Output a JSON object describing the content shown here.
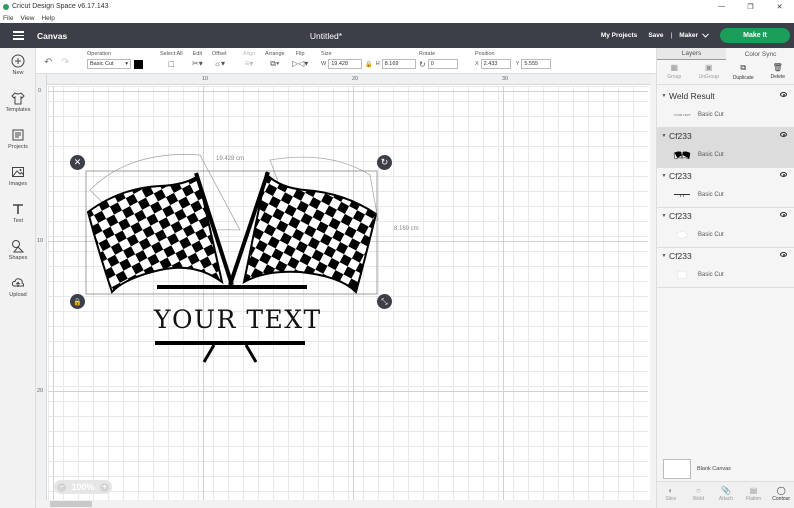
{
  "window": {
    "title": "Cricut Design Space  v6.17.143",
    "minimize": "—",
    "maximize": "❐",
    "close": "✕"
  },
  "menu": [
    "File",
    "View",
    "Help"
  ],
  "header": {
    "section": "Canvas",
    "doc_title": "Untitled*",
    "my_projects": "My Projects",
    "save": "Save",
    "separator": "|",
    "machine": "Maker",
    "make_it": "Make It"
  },
  "toolbar": {
    "operation_label": "Operation",
    "operation_value": "Basic Cut",
    "select_all": "Select All",
    "edit": "Edit",
    "offset": "Offset",
    "align": "Align",
    "arrange": "Arrange",
    "flip": "Flip",
    "size_label": "Size",
    "w_label": "W",
    "w_value": "19.428",
    "h_label": "H",
    "h_value": "8.169",
    "rotate_label": "Rotate",
    "rotate_value": "0",
    "position_label": "Position",
    "x_label": "X",
    "x_value": "2.433",
    "y_label": "Y",
    "y_value": "5.555"
  },
  "sidebar": [
    {
      "label": "New",
      "icon": "plus-icon"
    },
    {
      "label": "Templates",
      "icon": "shirt-icon"
    },
    {
      "label": "Projects",
      "icon": "projects-icon"
    },
    {
      "label": "Images",
      "icon": "image-icon"
    },
    {
      "label": "Text",
      "icon": "text-icon"
    },
    {
      "label": "Shapes",
      "icon": "shapes-icon"
    },
    {
      "label": "Upload",
      "icon": "upload-icon"
    }
  ],
  "ruler": {
    "top": [
      "0",
      "10",
      "20",
      "30"
    ],
    "left": [
      "0",
      "10",
      "20"
    ]
  },
  "canvas": {
    "width_label": "19.428 cm",
    "height_label": "8.169 cm",
    "your_text": "YOUR TEXT",
    "zoom": "100%",
    "zoom_minus": "−",
    "zoom_plus": "+"
  },
  "panel": {
    "tabs": [
      "Layers",
      "Color Sync"
    ],
    "actions": [
      "Group",
      "UnGroup",
      "Duplicate",
      "Delete"
    ],
    "layers": [
      {
        "name": "Weld Result",
        "op": "Basic Cut",
        "thumb_text": "YOUR TEXT"
      },
      {
        "name": "Cf233",
        "op": "Basic Cut"
      },
      {
        "name": "Cf233",
        "op": "Basic Cut"
      },
      {
        "name": "Cf233",
        "op": "Basic Cut"
      },
      {
        "name": "Cf233",
        "op": "Basic Cut"
      }
    ],
    "blank_canvas": "Blank Canvas",
    "bottom_actions": [
      "Slice",
      "Weld",
      "Attach",
      "Flatten",
      "Contour"
    ]
  },
  "colors": {
    "header": "#3c3f47",
    "make_it": "#1c9e5b",
    "selection": "#dcdcdc"
  }
}
